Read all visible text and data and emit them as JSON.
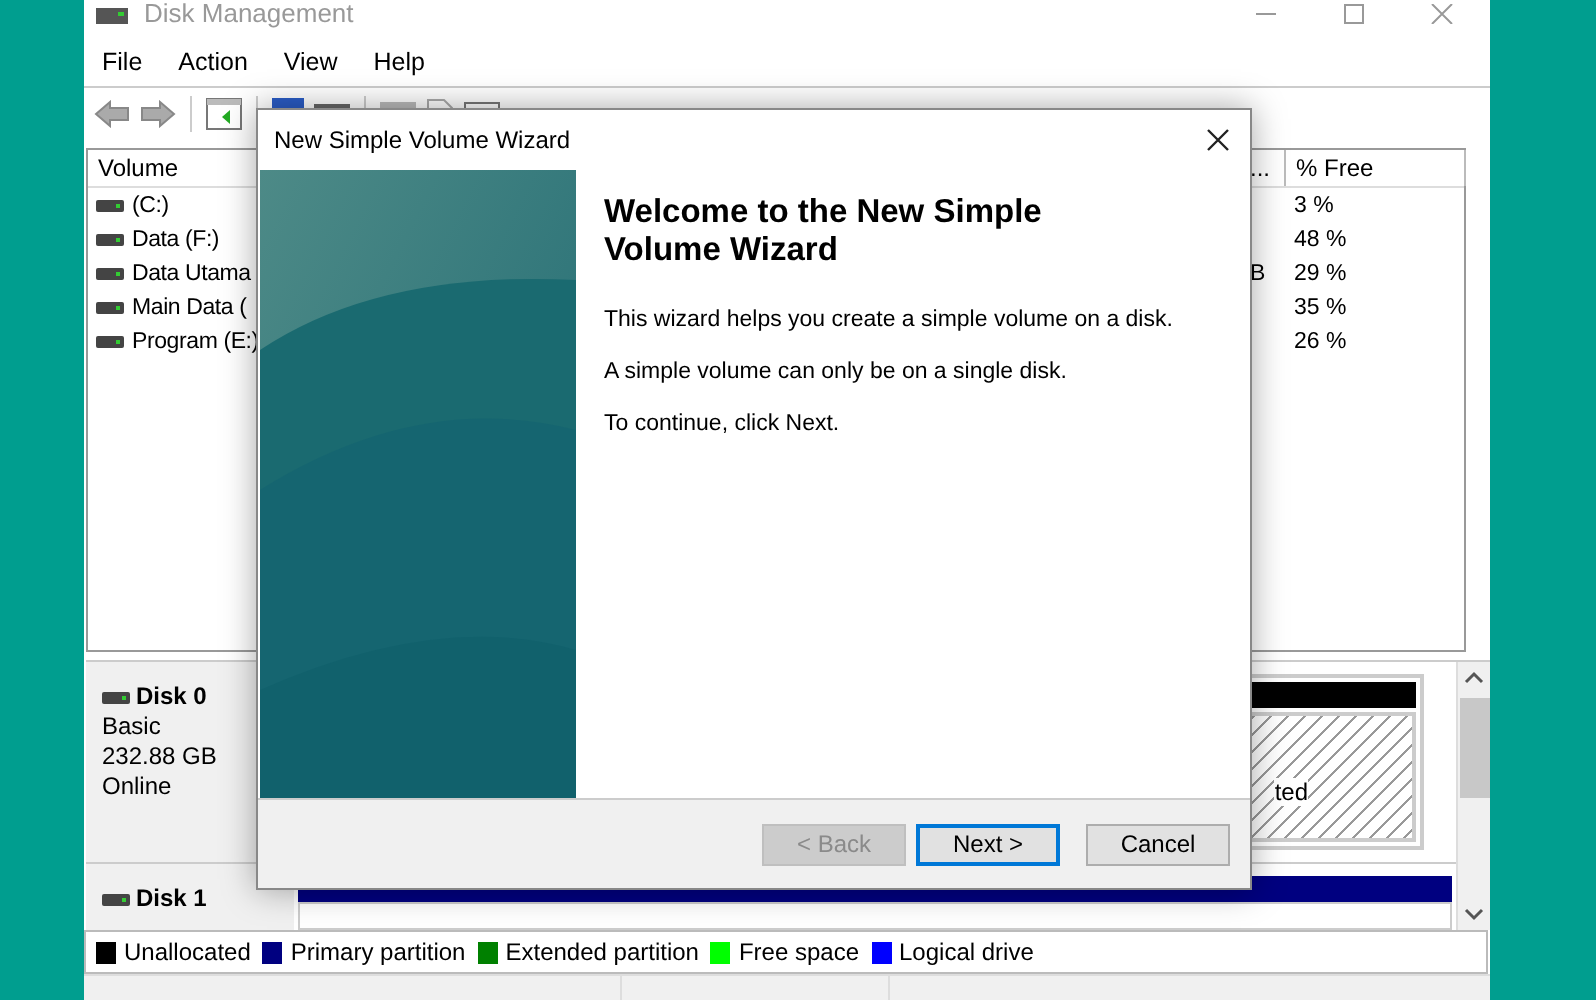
{
  "window": {
    "title": "Disk Management"
  },
  "menu": [
    "File",
    "Action",
    "View",
    "Help"
  ],
  "volume_list": {
    "columns": [
      {
        "label": "Volume"
      },
      {
        "label": "..."
      },
      {
        "label": "% Free"
      }
    ],
    "rows": [
      {
        "volume": "(C:)",
        "free": "3 %"
      },
      {
        "volume": "Data (F:)",
        "free": "48 %"
      },
      {
        "volume": "Data Utama",
        "column_2": "B",
        "free": "29 %"
      },
      {
        "volume": "Main Data (",
        "free": "35 %"
      },
      {
        "volume": "Program (E:)",
        "free": "26 %"
      }
    ]
  },
  "disks": [
    {
      "name": "Disk 0",
      "type": "Basic",
      "size": "232.88 GB",
      "status": "Online",
      "partition_label": "ted"
    },
    {
      "name": "Disk 1"
    }
  ],
  "legend": [
    {
      "label": "Unallocated",
      "color": "#000000"
    },
    {
      "label": "Primary partition",
      "color": "#000080"
    },
    {
      "label": "Extended partition",
      "color": "#008000"
    },
    {
      "label": "Free space",
      "color": "#00ff00"
    },
    {
      "label": "Logical drive",
      "color": "#0000ff"
    }
  ],
  "dialog": {
    "title": "New Simple Volume Wizard",
    "heading": "Welcome to the New Simple Volume Wizard",
    "paragraphs": [
      "This wizard helps you create a simple volume on a disk.",
      "A simple volume can only be on a single disk.",
      "To continue, click Next."
    ],
    "buttons": [
      {
        "label": "< Back",
        "disabled": true,
        "focused": false
      },
      {
        "label": "Next >",
        "disabled": false,
        "focused": true
      },
      {
        "label": "Cancel",
        "disabled": false,
        "focused": false
      }
    ]
  }
}
